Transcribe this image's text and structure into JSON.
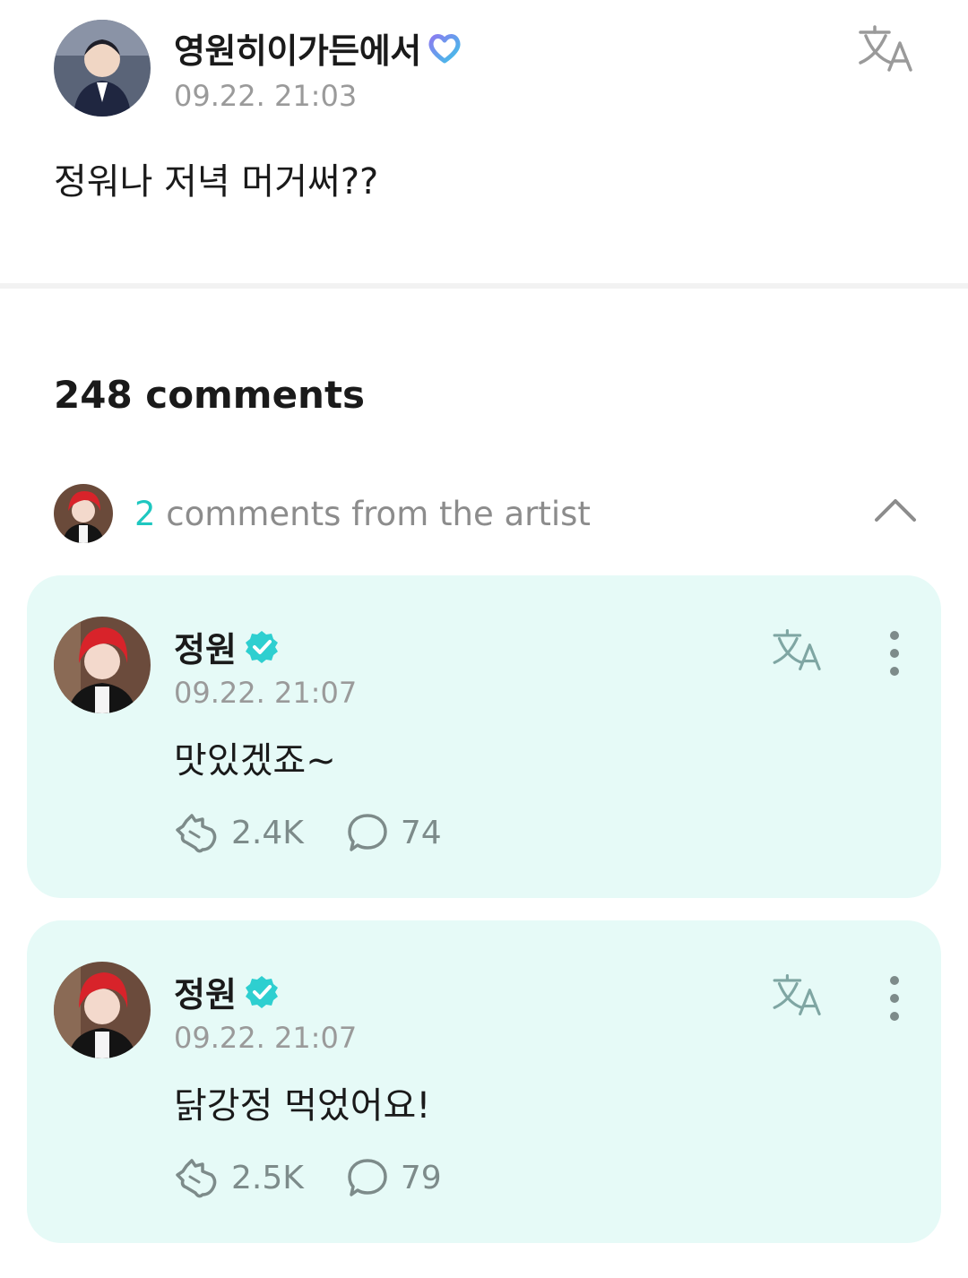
{
  "post": {
    "author": "영원히이가든에서",
    "date": "09.22. 21:03",
    "text": "정워나 저녁 머거써??"
  },
  "comments": {
    "count_label": "248 comments",
    "artist_summary": {
      "count": "2",
      "label": " comments from the artist"
    }
  },
  "artist_comments": [
    {
      "name": "정원",
      "date": "09.22. 21:07",
      "text": "맛있겠죠~",
      "likes": "2.4K",
      "replies": "74"
    },
    {
      "name": "정원",
      "date": "09.22. 21:07",
      "text": "닭강정 먹었어요!",
      "likes": "2.5K",
      "replies": "79"
    }
  ],
  "colors": {
    "accent": "#1ec7c0",
    "card_bg": "#e6faf7",
    "muted": "#9a9a9a"
  },
  "icons": {
    "translate": "translate-icon",
    "verified": "verified-badge-icon",
    "membership": "membership-heart-icon",
    "like": "cheer-hand-icon",
    "reply": "speech-bubble-icon",
    "more": "kebab-icon",
    "collapse": "chevron-up-icon"
  }
}
